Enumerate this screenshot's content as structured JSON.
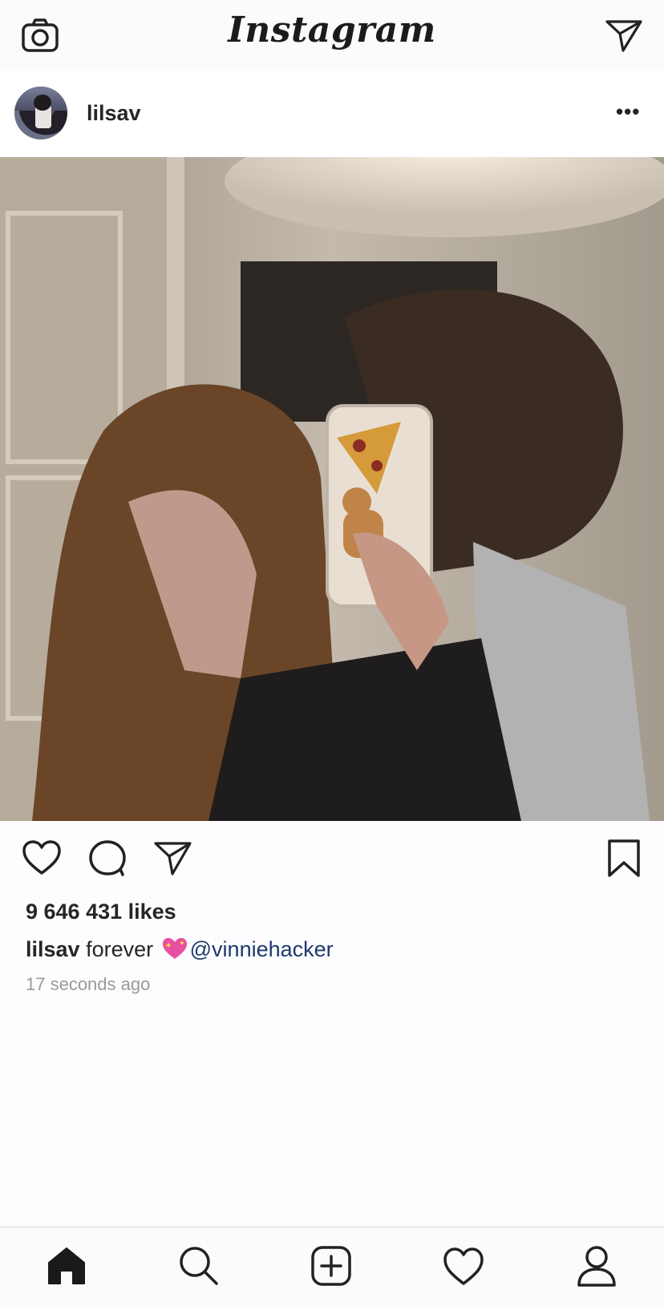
{
  "app": {
    "title": "Instagram"
  },
  "post": {
    "username": "lilsav",
    "more_label": "•••",
    "likes": "9 646 431 likes",
    "caption": {
      "user": "lilsav",
      "text": "forever",
      "emoji": "sparkling-heart",
      "mention": "@vinniehacker"
    },
    "time": "17 seconds ago"
  },
  "icons": {
    "top": [
      "camera-icon",
      "direct-message-icon"
    ],
    "actions": [
      "heart-icon",
      "comment-icon",
      "share-icon",
      "bookmark-icon"
    ],
    "tabs": [
      "home-icon",
      "search-icon",
      "new-post-icon",
      "activity-icon",
      "profile-icon"
    ]
  },
  "colors": {
    "mention": "#1d3a6d",
    "time": "#9a9a9a",
    "text": "#262626"
  }
}
